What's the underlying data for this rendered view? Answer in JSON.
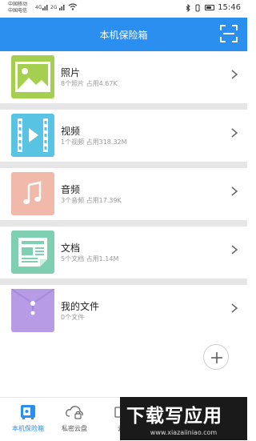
{
  "status_bar": {
    "carrier_1": "中国移动",
    "carrier_2": "中国电信",
    "sig_1": "4G",
    "sig_2": "2G",
    "time": "15:46"
  },
  "header": {
    "title": "本机保险箱"
  },
  "items": [
    {
      "title": "照片",
      "subtitle": "8个照片  占用4.67K",
      "color": "#a5cf4f",
      "icon": "image-icon"
    },
    {
      "title": "视频",
      "subtitle": "1个视频  占用318.32M",
      "color": "#58c3e3",
      "icon": "video-icon"
    },
    {
      "title": "音频",
      "subtitle": "3个音频  占用17.39K",
      "color": "#f0b9a9",
      "icon": "music-note-icon"
    },
    {
      "title": "文档",
      "subtitle": "5个文档  占用1.14M",
      "color": "#7fcfb2",
      "icon": "document-icon"
    },
    {
      "title": "我的文件",
      "subtitle": "0个文件",
      "color": "#b79ce5",
      "icon": "folder-envelope-icon"
    }
  ],
  "tabs": [
    {
      "label": "本机保险箱",
      "active": true,
      "icon": "safe-icon"
    },
    {
      "label": "私密云盘",
      "active": false,
      "icon": "cloud-lock-icon"
    },
    {
      "label": "云",
      "active": false,
      "icon": "cloud-icon"
    }
  ],
  "watermark": {
    "big": "下载写应用",
    "small": "www.xiazaiiniao.com"
  },
  "colors": {
    "accent": "#2b8ff0"
  }
}
